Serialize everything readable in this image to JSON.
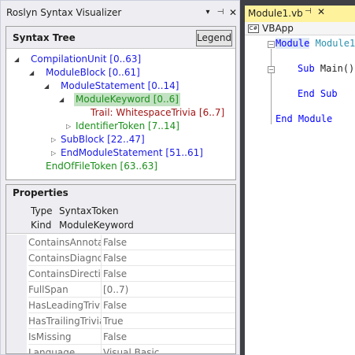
{
  "tool_window": {
    "title": "Roslyn Syntax Visualizer",
    "dropdown_icon": "dropdown-icon",
    "pin_icon": "pin-icon",
    "close_icon": "close-icon"
  },
  "syntax_tree": {
    "header": "Syntax Tree",
    "legend_label": "Legend",
    "nodes": [
      {
        "label": "CompilationUnit [0..63]"
      },
      {
        "label": "ModuleBlock [0..61]"
      },
      {
        "label": "ModuleStatement [0..14]"
      },
      {
        "label": "ModuleKeyword [0..6]"
      },
      {
        "label": "Trail: WhitespaceTrivia [6..7]"
      },
      {
        "label": "IdentifierToken [7..14]"
      },
      {
        "label": "SubBlock [22..47]"
      },
      {
        "label": "EndModuleStatement [51..61]"
      },
      {
        "label": "EndOfFileToken [63..63]"
      }
    ]
  },
  "properties": {
    "header": "Properties",
    "type_label": "Type",
    "type_value": "SyntaxToken",
    "kind_label": "Kind",
    "kind_value": "ModuleKeyword",
    "rows": [
      {
        "name": "ContainsAnnota",
        "value": "False"
      },
      {
        "name": "ContainsDiagnos",
        "value": "False"
      },
      {
        "name": "ContainsDirectiv",
        "value": "False"
      },
      {
        "name": "FullSpan",
        "value": "[0..7)"
      },
      {
        "name": "HasLeadingTrivia",
        "value": "False"
      },
      {
        "name": "HasTrailingTrivia",
        "value": "True"
      },
      {
        "name": "IsMissing",
        "value": "False"
      },
      {
        "name": "Language",
        "value": "Visual Basic"
      }
    ]
  },
  "editor": {
    "tab_label": "Module1.vb",
    "nav_project": "VBApp",
    "nav_icon_text": "C#",
    "code": {
      "line1_kw": "Module",
      "line1_name": "Module1",
      "line2_kw": "Sub",
      "line2_rest": "Main()",
      "line3": "End Sub",
      "line4": "End Module"
    }
  },
  "colors": {
    "tab_active": "#fff29d",
    "node_blue": "#1a1ae6",
    "node_green": "#1b8f1b",
    "trivia_red": "#a31515",
    "selection": "#c3e2c3"
  }
}
